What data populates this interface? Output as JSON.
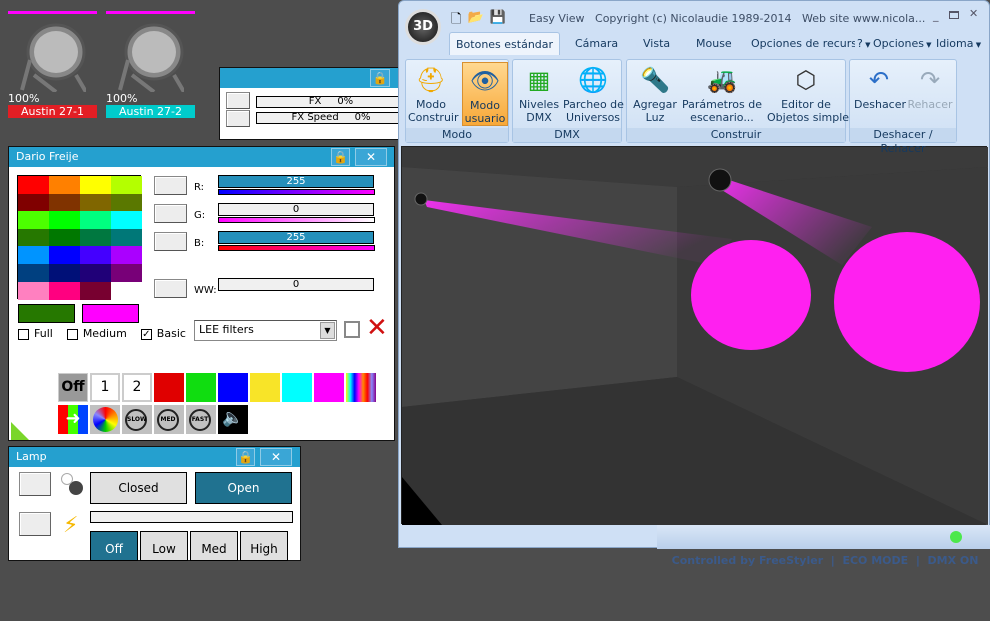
{
  "fixtures": [
    {
      "name": "Austin 27-1",
      "level": "100%",
      "color": "#e31e24"
    },
    {
      "name": "Austin 27-2",
      "level": "100%",
      "color": "#00cccc"
    }
  ],
  "fx_window": {
    "rows": [
      {
        "label": "FX",
        "value": "0%"
      },
      {
        "label": "FX Speed",
        "value": "0%"
      }
    ]
  },
  "color_window": {
    "title": "Dario Freije",
    "palette": [
      "#ff0000",
      "#ff8000",
      "#ffff00",
      "#b4ff00",
      "#800000",
      "#803300",
      "#806600",
      "#5a7800",
      "#4cff00",
      "#00ff00",
      "#00ff80",
      "#00ffff",
      "#267800",
      "#007800",
      "#007840",
      "#007878",
      "#0094ff",
      "#0000ff",
      "#4400ff",
      "#aa00ff",
      "#004080",
      "#001078",
      "#200078",
      "#780078",
      "#ff80c0",
      "#ff0080",
      "#780030",
      "#ffffff"
    ],
    "current_colors": [
      "#267800",
      "#ff00ff"
    ],
    "channels": [
      {
        "label": "R:",
        "value": "255"
      },
      {
        "label": "G:",
        "value": "0"
      },
      {
        "label": "B:",
        "value": "255"
      },
      {
        "label": "WW:",
        "value": "0"
      }
    ],
    "checkboxes": [
      {
        "label": "Full",
        "checked": false
      },
      {
        "label": "Medium",
        "checked": false
      },
      {
        "label": "Basic",
        "checked": true
      }
    ],
    "filter_select": "LEE filters",
    "quick_buttons": {
      "off": "Off",
      "one": "1",
      "two": "2"
    },
    "quick_colors": [
      "#e00000",
      "#10dd10",
      "#0000ff",
      "#f8e428",
      "#00ffff",
      "#ff00ff"
    ],
    "speed_buttons": [
      "SLOW",
      "MED",
      "FAST"
    ]
  },
  "lamp_window": {
    "title": "Lamp",
    "closed": "Closed",
    "open": "Open",
    "levels": [
      "Off",
      "Low",
      "Med",
      "High"
    ]
  },
  "main": {
    "title": "Easy View   Copyright (c) Nicolaudie 1989-2014   Web site www.nicola...",
    "tabs": [
      "Botones estándar",
      "Cámara",
      "Vista",
      "Mouse",
      "Opciones de recursc"
    ],
    "menus": [
      "?",
      "Opciones",
      "Idioma"
    ],
    "groups": [
      {
        "label": "Modo",
        "buttons": [
          "Modo\nConstruir",
          "Modo\nusuario"
        ]
      },
      {
        "label": "DMX",
        "buttons": [
          "Niveles\nDMX",
          "Parcheo de\nUniversos"
        ]
      },
      {
        "label": "Construir",
        "buttons": [
          "Agregar\nLuz",
          "Parámetros de\nescenario...",
          "Editor de\nObjetos simples"
        ]
      },
      {
        "label": "Deshacer / Rehacer",
        "buttons": [
          "Deshacer",
          "Rehacer"
        ]
      }
    ],
    "status": {
      "controlled": "Controlled by FreeStyler",
      "eco": "ECO MODE",
      "dmx": "DMX ON"
    }
  }
}
